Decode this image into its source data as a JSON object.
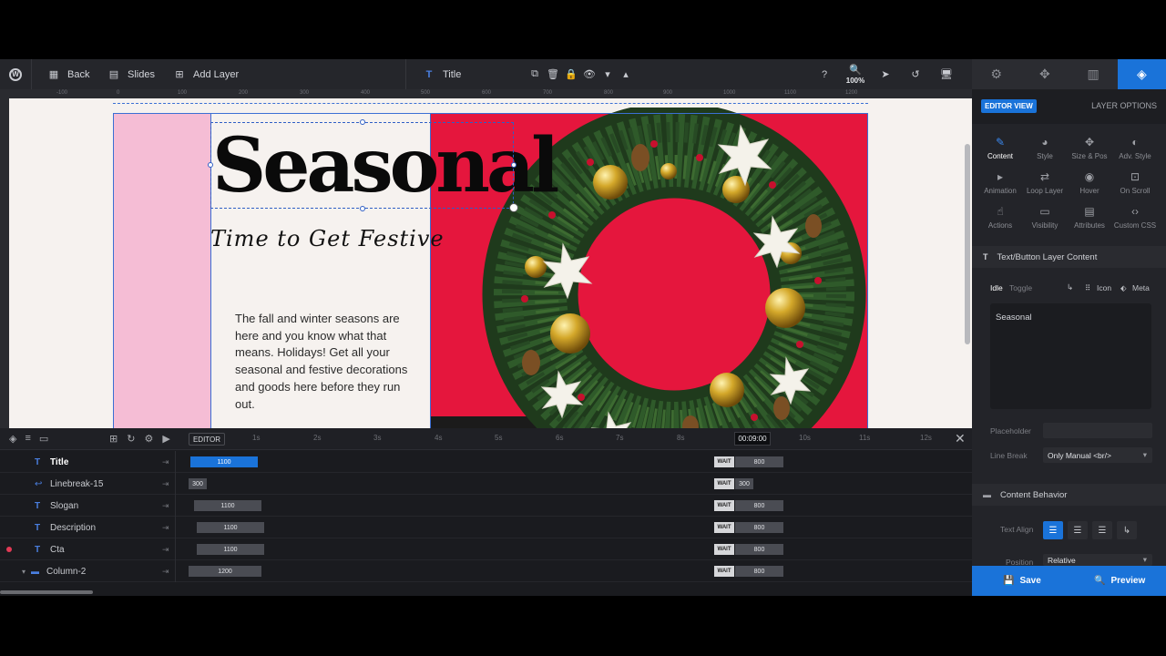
{
  "toolbar": {
    "back": "Back",
    "slides": "Slides",
    "add_layer": "Add Layer",
    "layer_title": "Title",
    "zoom": "100%"
  },
  "ruler": [
    "-100",
    "0",
    "100",
    "200",
    "300",
    "400",
    "500",
    "600",
    "700",
    "800",
    "900",
    "1000",
    "1100",
    "1200"
  ],
  "canvas": {
    "title": "Seasonal",
    "slogan": "Time to Get Festive",
    "description": "The fall and winter seasons are here and you know what that means. Holidays! Get all your seasonal and festive decorations and goods here before they run out."
  },
  "timeline": {
    "editor_label": "EDITOR",
    "current_time": "00:09:00",
    "ticks": [
      "1s",
      "2s",
      "3s",
      "4s",
      "5s",
      "6s",
      "7s",
      "8s",
      "10s",
      "11s",
      "12s"
    ],
    "wait_label": "WAIT",
    "rows": [
      {
        "name": "Title",
        "duration": "1100",
        "wait": "800"
      },
      {
        "name": "Linebreak-15",
        "duration": "300",
        "wait": "300"
      },
      {
        "name": "Slogan",
        "duration": "1100",
        "wait": "800"
      },
      {
        "name": "Description",
        "duration": "1100",
        "wait": "800"
      },
      {
        "name": "Cta",
        "duration": "1100",
        "wait": "800"
      },
      {
        "name": "Column-2",
        "duration": "1200",
        "wait": "800"
      }
    ]
  },
  "panel": {
    "editor_view": "EDITOR VIEW",
    "layer_options": "LAYER OPTIONS",
    "grid": [
      "Content",
      "Style",
      "Size & Pos",
      "Adv. Style",
      "Animation",
      "Loop Layer",
      "Hover",
      "On Scroll",
      "Actions",
      "Visibility",
      "Attributes",
      "Custom CSS"
    ],
    "text_section": "Text/Button Layer Content",
    "idle": "Idle",
    "toggle": "Toggle",
    "icon": "Icon",
    "meta": "Meta",
    "content_value": "Seasonal",
    "placeholder_label": "Placeholder",
    "line_break_label": "Line Break",
    "line_break_value": "Only Manual <br/>",
    "content_behavior": "Content Behavior",
    "text_align_label": "Text Align",
    "position_label": "Position",
    "position_value": "Relative",
    "save": "Save",
    "preview": "Preview"
  },
  "colors": {
    "accent": "#1a73d9",
    "canvas_red": "#e5163d",
    "canvas_pink": "#f5bdd5"
  }
}
